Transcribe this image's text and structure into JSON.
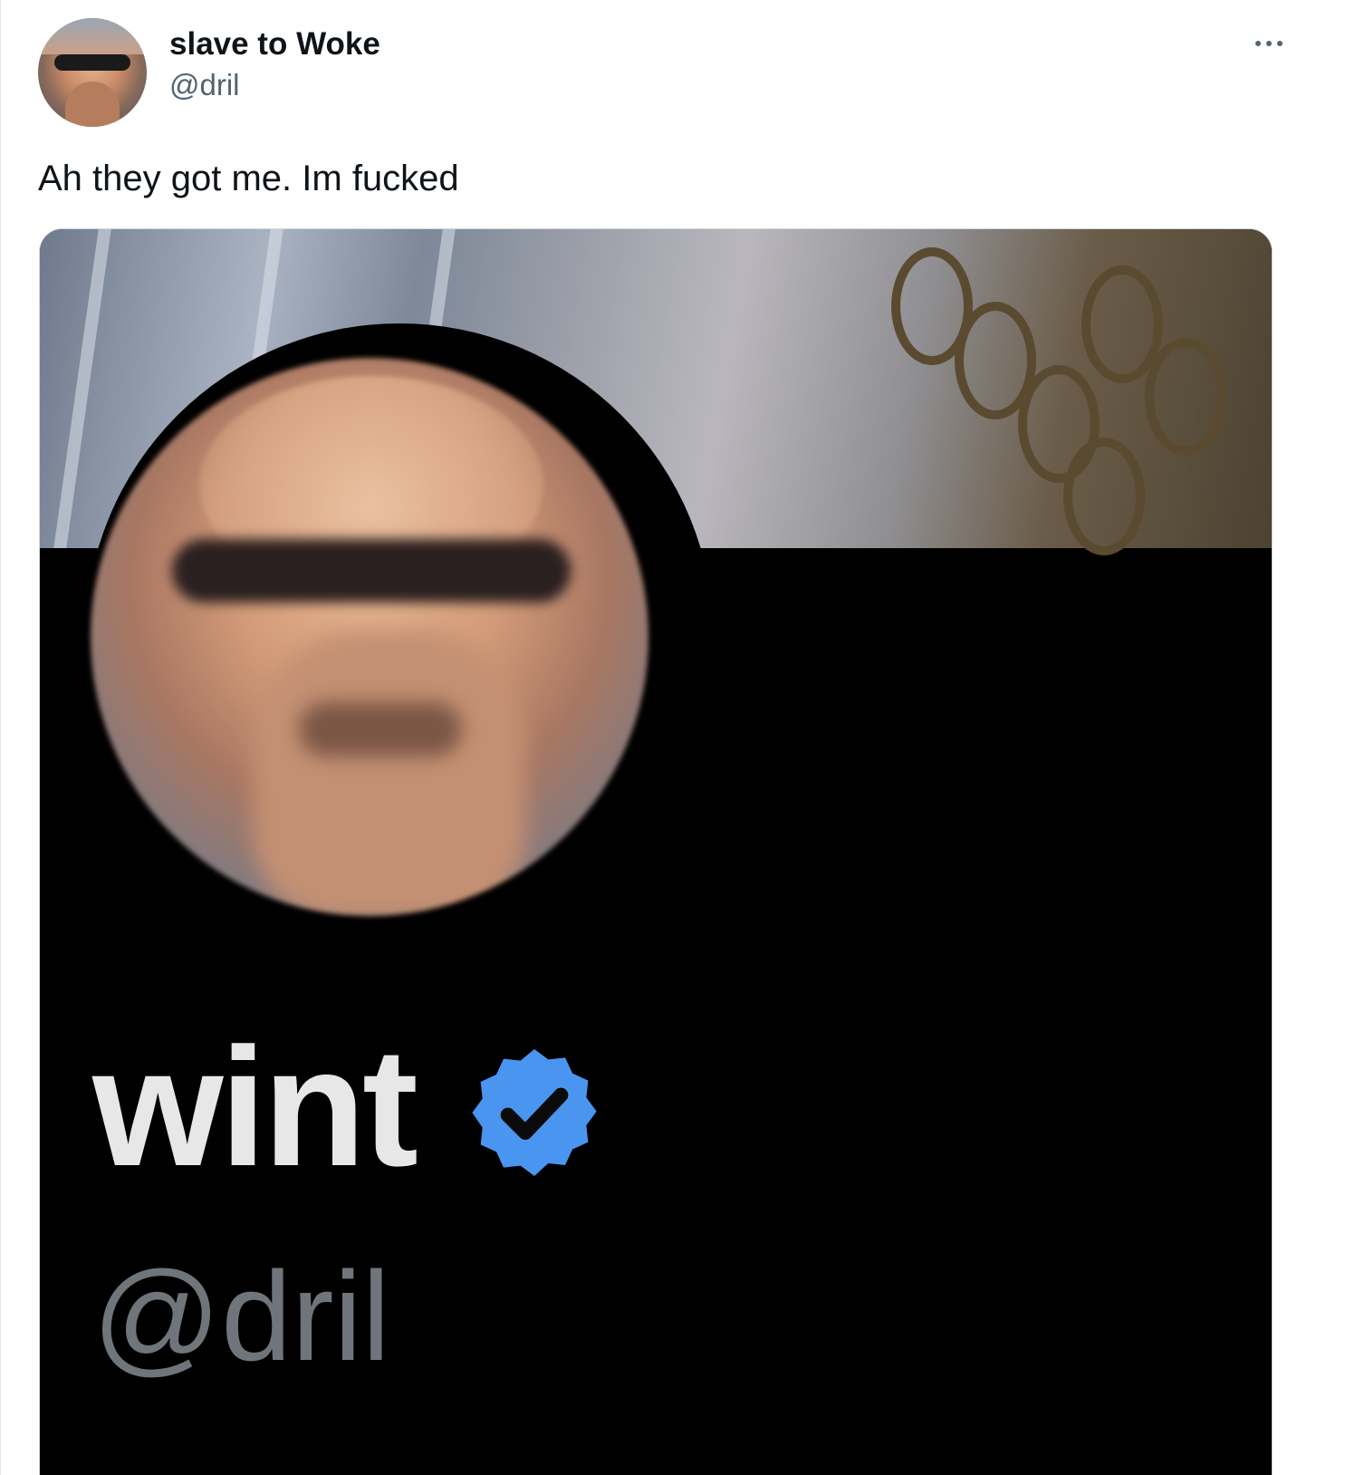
{
  "tweet": {
    "author": {
      "display_name": "slave to Woke",
      "handle": "@dril"
    },
    "text": "Ah they got me. Im fucked",
    "more_icon": "more-horizontal-icon"
  },
  "media": {
    "profile": {
      "name": "wint",
      "handle": "@dril",
      "verified": true,
      "verified_icon": "verified-badge-icon"
    }
  },
  "colors": {
    "text_primary": "#0f1419",
    "text_secondary": "#536471",
    "verified_blue": "#4a95f0",
    "media_background": "#000000"
  }
}
